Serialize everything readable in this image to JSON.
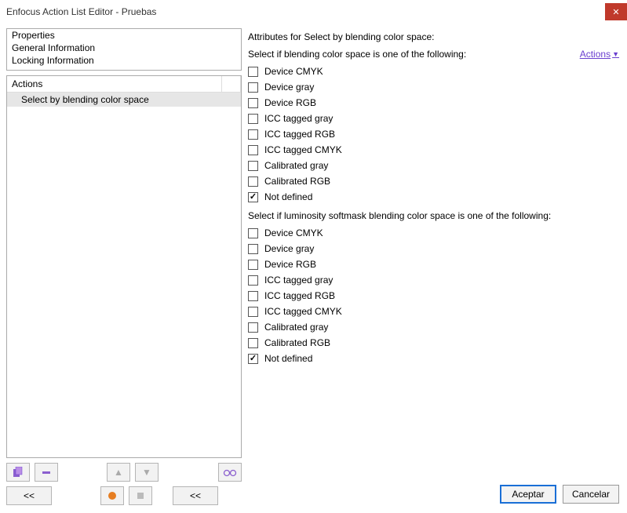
{
  "window": {
    "title": "Enfocus Action List Editor - Pruebas"
  },
  "propertiesList": {
    "items": [
      "Properties",
      "General Information",
      "Locking Information"
    ]
  },
  "actionsPanel": {
    "header": "Actions",
    "items": [
      "Select by blending color space"
    ]
  },
  "toolbar": {
    "row1": {
      "duplicate": "dup",
      "remove": "rem",
      "up": "▲",
      "down": "▼",
      "glasses": "view"
    },
    "row2": {
      "prev": "<<",
      "record": "rec",
      "stop": "stop",
      "next": "<<"
    }
  },
  "attributes": {
    "title": "Attributes for Select by blending color space:",
    "sub1": "Select if blending color space is one of the following:",
    "actionsLink": "Actions",
    "group1": [
      {
        "label": "Device CMYK",
        "checked": false
      },
      {
        "label": "Device gray",
        "checked": false
      },
      {
        "label": "Device RGB",
        "checked": false
      },
      {
        "label": "ICC tagged gray",
        "checked": false
      },
      {
        "label": "ICC tagged RGB",
        "checked": false
      },
      {
        "label": "ICC tagged CMYK",
        "checked": false
      },
      {
        "label": "Calibrated gray",
        "checked": false
      },
      {
        "label": "Calibrated RGB",
        "checked": false
      },
      {
        "label": "Not defined",
        "checked": true
      }
    ],
    "sub2": "Select if luminosity softmask blending color space is one of the following:",
    "group2": [
      {
        "label": "Device CMYK",
        "checked": false
      },
      {
        "label": "Device gray",
        "checked": false
      },
      {
        "label": "Device RGB",
        "checked": false
      },
      {
        "label": "ICC tagged gray",
        "checked": false
      },
      {
        "label": "ICC tagged RGB",
        "checked": false
      },
      {
        "label": "ICC tagged CMYK",
        "checked": false
      },
      {
        "label": "Calibrated gray",
        "checked": false
      },
      {
        "label": "Calibrated RGB",
        "checked": false
      },
      {
        "label": "Not defined",
        "checked": true
      }
    ]
  },
  "footer": {
    "accept": "Aceptar",
    "cancel": "Cancelar"
  }
}
